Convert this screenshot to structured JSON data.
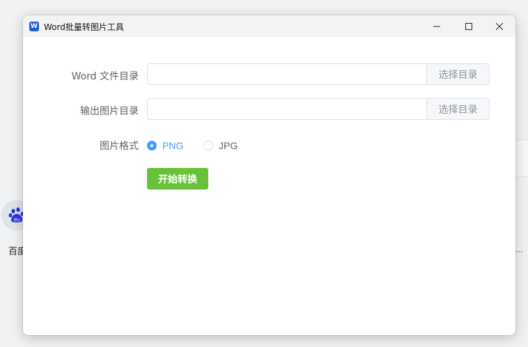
{
  "window": {
    "title": "Word批量转图片工具",
    "app_icon_letter": "W"
  },
  "form": {
    "word_dir": {
      "label": "Word 文件目录",
      "value": "",
      "browse_label": "选择目录"
    },
    "output_dir": {
      "label": "输出图片目录",
      "value": "",
      "browse_label": "选择目录"
    },
    "format": {
      "label": "图片格式",
      "options": [
        {
          "label": "PNG",
          "checked": true
        },
        {
          "label": "JPG",
          "checked": false
        }
      ]
    },
    "convert_label": "开始转换"
  },
  "background": {
    "desktop_item_label": "百度",
    "ellipsis": "..."
  },
  "colors": {
    "primary": "#409eff",
    "success": "#67c23a",
    "app_icon": "#1e62d8"
  },
  "icons": [
    "word-app-icon",
    "minimize-icon",
    "maximize-icon",
    "close-icon",
    "baidu-paw-icon"
  ]
}
